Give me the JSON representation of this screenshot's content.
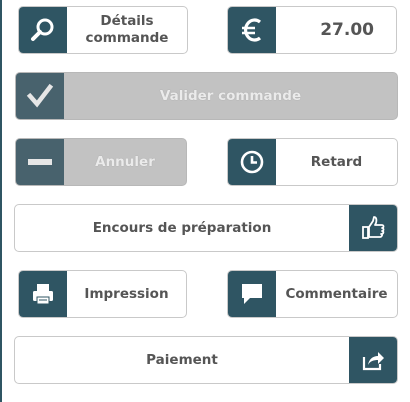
{
  "buttons": {
    "details": {
      "label": "Détails commande",
      "line1": "Détails",
      "line2": "commande",
      "icon": "search-icon"
    },
    "amount": {
      "value": "27.00",
      "icon": "euro-icon"
    },
    "validate": {
      "label": "Valider commande",
      "icon": "checkmark-icon",
      "enabled": false
    },
    "cancel": {
      "label": "Annuler",
      "icon": "minus-icon",
      "enabled": false
    },
    "delay": {
      "label": "Retard",
      "icon": "clock-icon"
    },
    "in_progress": {
      "label": "Encours de préparation",
      "icon": "thumbs-up-icon"
    },
    "print": {
      "label": "Impression",
      "icon": "printer-icon"
    },
    "comment": {
      "label": "Commentaire",
      "icon": "speech-bubble-icon"
    },
    "payment": {
      "label": "Paiement",
      "icon": "share-arrow-icon"
    }
  },
  "colors": {
    "icon_background": "#2f5563",
    "disabled_background": "#c2c2c2",
    "label_text": "#555555",
    "border": "#c9c9c9"
  }
}
